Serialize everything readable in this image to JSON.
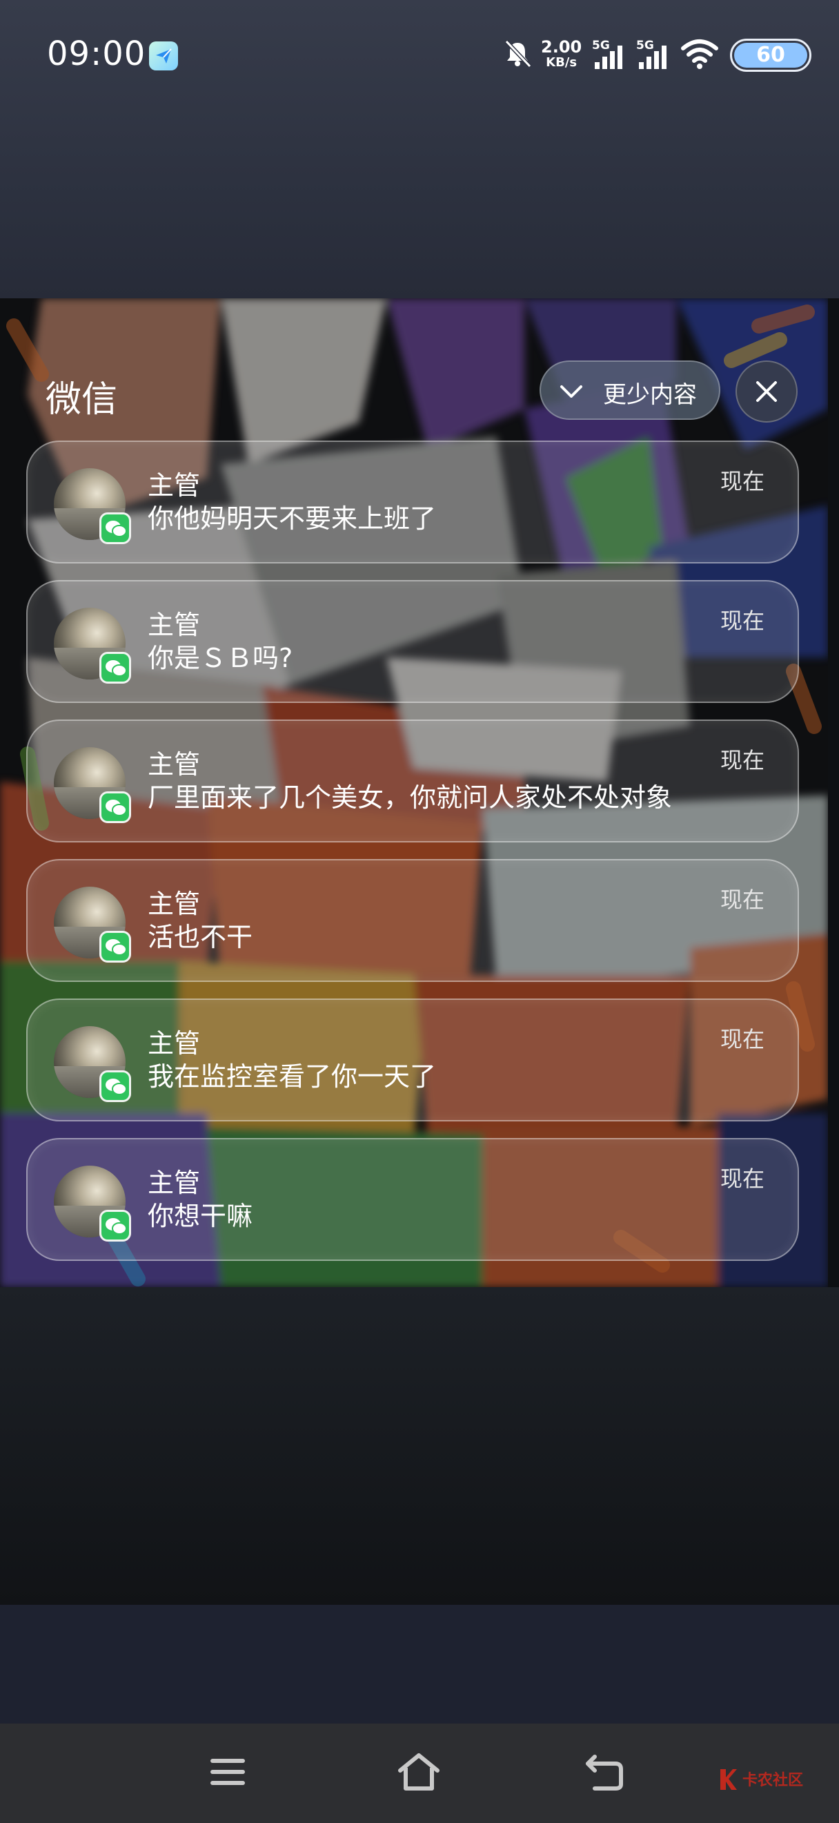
{
  "status_bar": {
    "time": "09:00",
    "net_speed_value": "2.00",
    "net_speed_unit": "KB/s",
    "sim1_label": "5G",
    "sim2_label": "5G",
    "battery_level": "60",
    "icons": [
      "app-icon",
      "mute-icon",
      "signal-icon",
      "signal-icon",
      "wifi-icon",
      "battery-icon"
    ]
  },
  "notification_group": {
    "app_name": "微信",
    "collapse_label": "更少内容",
    "items": [
      {
        "sender": "主管",
        "message": "你他妈明天不要来上班了",
        "time": "现在"
      },
      {
        "sender": "主管",
        "message": "你是ＳＢ吗?",
        "time": "现在"
      },
      {
        "sender": "主管",
        "message": "厂里面来了几个美女，你就问人家处不处对象",
        "time": "现在"
      },
      {
        "sender": "主管",
        "message": "活也不干",
        "time": "现在"
      },
      {
        "sender": "主管",
        "message": "我在监控室看了你一天了",
        "time": "现在"
      },
      {
        "sender": "主管",
        "message": "你想干嘛",
        "time": "现在"
      }
    ]
  },
  "nav_bar": {
    "icons": [
      "menu-icon",
      "home-icon",
      "back-icon"
    ]
  },
  "watermark": {
    "text": "卡农社区"
  },
  "colors": {
    "accent_wechat": "#2fc35d",
    "battery": "#8fc5ff"
  }
}
